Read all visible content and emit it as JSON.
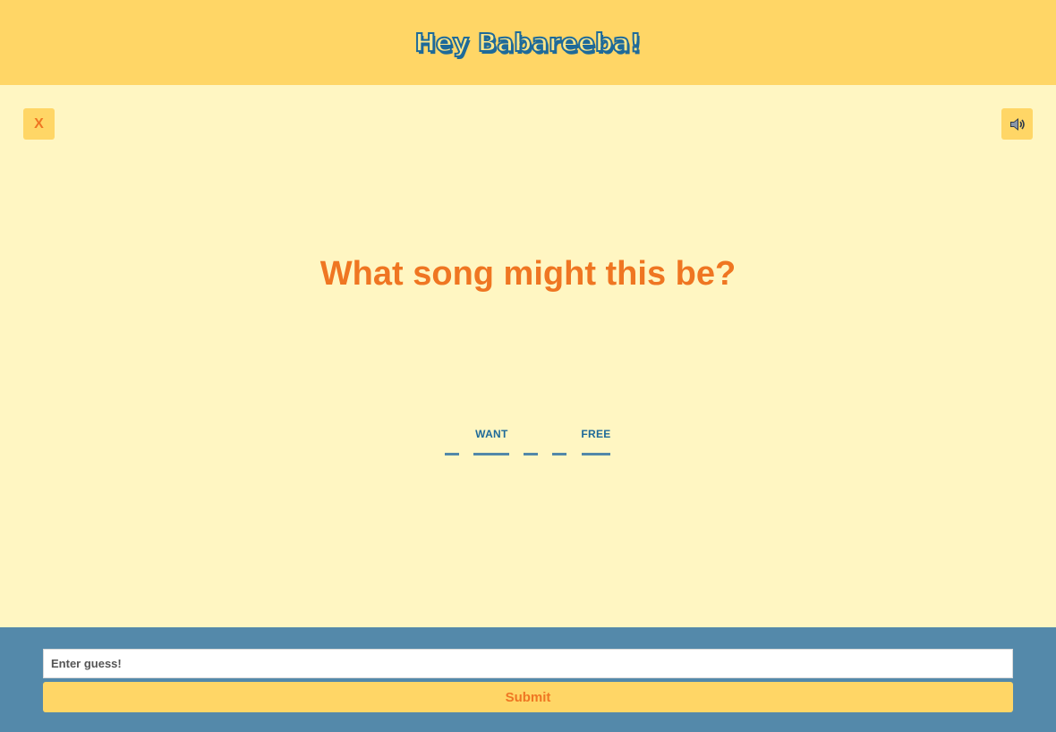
{
  "header": {
    "logo_text": "Hey Babareeba!"
  },
  "controls": {
    "close_label": "X",
    "sound_icon": "speaker-icon"
  },
  "game": {
    "question": "What song might this be?",
    "slots": [
      {
        "word": "",
        "width": 16
      },
      {
        "word": "WANT",
        "width": 40
      },
      {
        "word": "",
        "width": 16
      },
      {
        "word": "",
        "width": 16
      },
      {
        "word": "FREE",
        "width": 32
      }
    ]
  },
  "footer": {
    "guess_placeholder": "Enter guess!",
    "guess_value": "",
    "submit_label": "Submit"
  },
  "colors": {
    "header_bg": "#ffd666",
    "page_bg": "#fff6c2",
    "accent_orange": "#ef7622",
    "blue": "#1e6a99",
    "footer_bg": "#5489aa"
  }
}
